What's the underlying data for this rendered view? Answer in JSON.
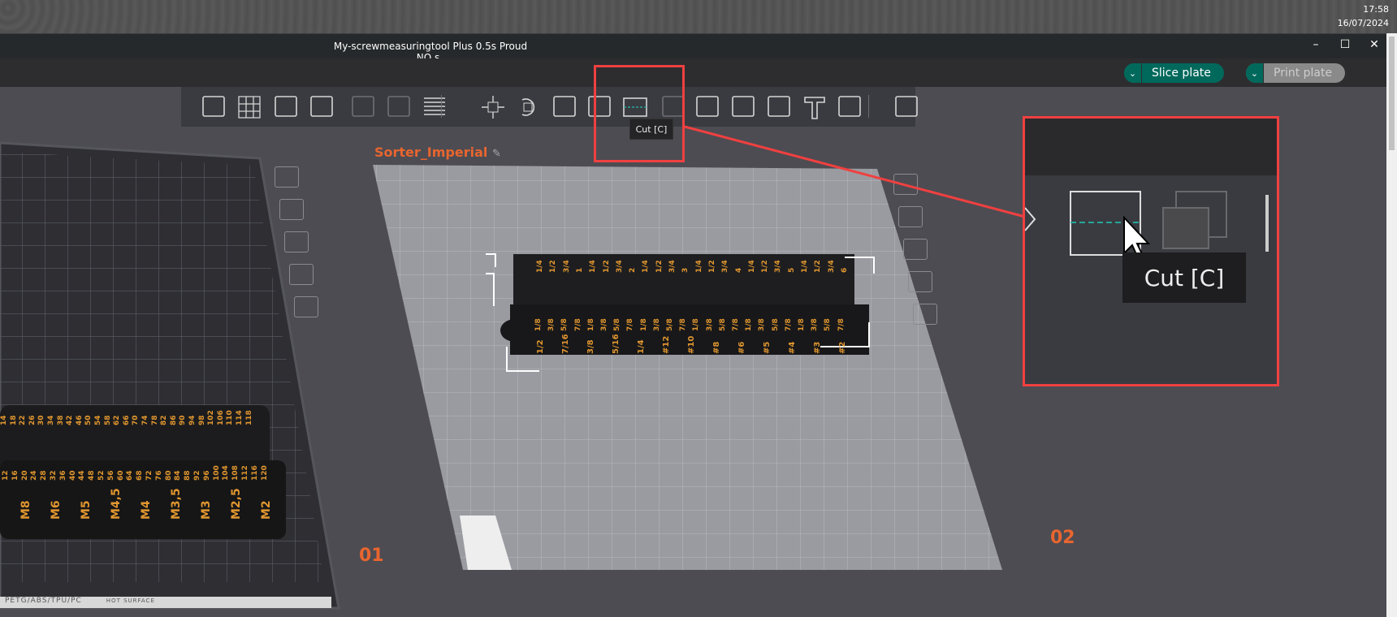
{
  "taskbar": {
    "time": "17:58",
    "date": "16/07/2024"
  },
  "window": {
    "title": "My-screwmeasuringtool Plus 0.5s Proud NO s_",
    "minimize": "–",
    "maximize": "☐",
    "close": "✕"
  },
  "top_actions": {
    "slice_label": "Slice plate",
    "print_label": "Print plate",
    "dropdown": "⌄",
    "accent": "#00695c"
  },
  "toolbar": {
    "icons": [
      "add-object",
      "arrange",
      "auto-orient",
      "plate-settings",
      "split-objects",
      "split-parts",
      "variable-layer-height",
      "move",
      "rotate",
      "scale",
      "lay-on-face",
      "cut",
      "boolean",
      "support-paint",
      "seam-paint",
      "mmu-paint",
      "text-emboss",
      "measure",
      "assembly"
    ],
    "tooltip": "Cut [C]"
  },
  "callout": {
    "tooltip": "Cut [C]"
  },
  "plates": {
    "plate1": {
      "number": "01",
      "material": "PETG/ABS/TPU/PC",
      "warning": "HOT SURFACE"
    },
    "plate2": {
      "number": "02",
      "name": "Sorter_Imperial"
    }
  },
  "models": {
    "imperial": {
      "top_row": [
        "1/4",
        "1/2",
        "3/4",
        "1",
        "1/4",
        "1/2",
        "3/4",
        "2",
        "1/4",
        "1/2",
        "3/4",
        "3",
        "1/4",
        "1/2",
        "3/4",
        "4",
        "1/4",
        "1/2",
        "3/4",
        "5",
        "1/4",
        "1/2",
        "3/4",
        "6"
      ],
      "fraction_row": [
        "1/8",
        "3/8",
        "5/8",
        "7/8",
        "1/8",
        "3/8",
        "5/8",
        "7/8",
        "1/8",
        "3/8",
        "5/8",
        "7/8",
        "1/8",
        "3/8",
        "5/8",
        "7/8",
        "1/8",
        "3/8",
        "5/8",
        "7/8",
        "1/8",
        "3/8",
        "5/8",
        "7/8"
      ],
      "sizes": [
        "1/2",
        "7/16",
        "3/8",
        "5/16",
        "1/4",
        "#12",
        "#10",
        "#8",
        "#6",
        "#5",
        "#4",
        "#3",
        "#2"
      ]
    },
    "metric": {
      "top_row": [
        "14",
        "18",
        "22",
        "26",
        "30",
        "34",
        "38",
        "42",
        "46",
        "50",
        "54",
        "58",
        "62",
        "66",
        "70",
        "74",
        "78",
        "82",
        "86",
        "90",
        "94",
        "98",
        "102",
        "106",
        "110",
        "114",
        "118"
      ],
      "mid_row": [
        "12",
        "16",
        "20",
        "24",
        "28",
        "32",
        "36",
        "40",
        "44",
        "48",
        "52",
        "56",
        "60",
        "64",
        "68",
        "72",
        "76",
        "80",
        "84",
        "88",
        "92",
        "96",
        "100",
        "104",
        "108",
        "112",
        "116",
        "120"
      ],
      "sizes": [
        "M8",
        "M6",
        "M5",
        "M4,5",
        "M4",
        "M3,5",
        "M3",
        "M2,5",
        "M2"
      ]
    }
  }
}
